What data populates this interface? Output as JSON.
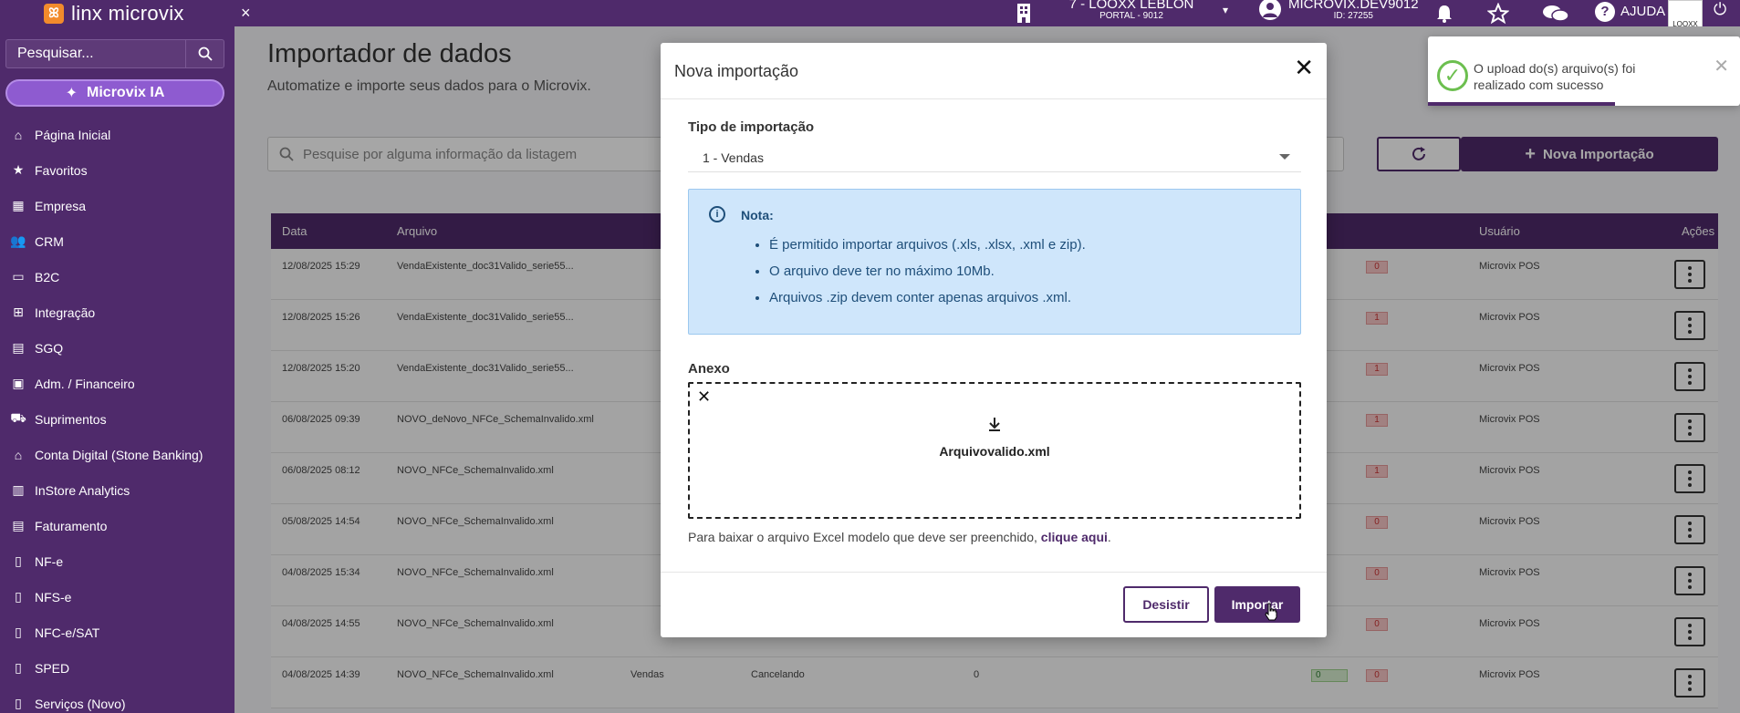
{
  "topbar": {
    "brand": "linx microvix",
    "close_glyph": "×",
    "store_name": "7 - LOOXX LEBLON",
    "store_portal": "PORTAL - 9012",
    "user_name": "MICROVIX.DEV9012",
    "user_id": "ID: 27255",
    "help_label": "AJUDA",
    "brand_badge": "LOOXX"
  },
  "sidebar": {
    "search_placeholder": "Pesquisar...",
    "ia_label": "Microvix IA",
    "items": [
      {
        "label": "Página Inicial",
        "icon": "home-icon"
      },
      {
        "label": "Favoritos",
        "icon": "star-icon"
      },
      {
        "label": "Empresa",
        "icon": "building-icon"
      },
      {
        "label": "CRM",
        "icon": "users-icon"
      },
      {
        "label": "B2C",
        "icon": "laptop-icon"
      },
      {
        "label": "Integração",
        "icon": "sitemap-icon"
      },
      {
        "label": "SGQ",
        "icon": "clipboard-icon"
      },
      {
        "label": "Adm. / Financeiro",
        "icon": "money-icon"
      },
      {
        "label": "Suprimentos",
        "icon": "truck-icon"
      },
      {
        "label": "Conta Digital (Stone Banking)",
        "icon": "bank-icon"
      },
      {
        "label": "InStore Analytics",
        "icon": "chart-icon"
      },
      {
        "label": "Faturamento",
        "icon": "invoice-icon"
      },
      {
        "label": "NF-e",
        "icon": "file-icon"
      },
      {
        "label": "NFS-e",
        "icon": "file-icon"
      },
      {
        "label": "NFC-e/SAT",
        "icon": "file-icon"
      },
      {
        "label": "SPED",
        "icon": "file-icon"
      },
      {
        "label": "Serviços (Novo)",
        "icon": "file-icon"
      }
    ]
  },
  "main": {
    "title": "Importador de dados",
    "subtitle": "Automatize e importe seus dados para o Microvix.",
    "search_placeholder": "Pesquise por alguma informação da listagem",
    "new_button": "Nova Importação",
    "columns": {
      "data": "Data",
      "arquivo": "Arquivo",
      "usuario": "Usuário",
      "acoes": "Ações"
    },
    "rows": [
      {
        "data": "12/08/2025 15:29",
        "arquivo": "VendaExistente_doc31Valido_serie55...",
        "usuario": "Microvix POS",
        "err": "0"
      },
      {
        "data": "12/08/2025 15:26",
        "arquivo": "VendaExistente_doc31Valido_serie55...",
        "usuario": "Microvix POS",
        "err": "1"
      },
      {
        "data": "12/08/2025 15:20",
        "arquivo": "VendaExistente_doc31Valido_serie55...",
        "usuario": "Microvix POS",
        "err": "1"
      },
      {
        "data": "06/08/2025 09:39",
        "arquivo": "NOVO_deNovo_NFCe_SchemaInvalido.xml",
        "usuario": "Microvix POS",
        "err": "1"
      },
      {
        "data": "06/08/2025 08:12",
        "arquivo": "NOVO_NFCe_SchemaInvalido.xml",
        "usuario": "Microvix POS",
        "err": "1"
      },
      {
        "data": "05/08/2025 14:54",
        "arquivo": "NOVO_NFCe_SchemaInvalido.xml",
        "usuario": "Microvix POS",
        "err": "0"
      },
      {
        "data": "04/08/2025 15:34",
        "arquivo": "NOVO_NFCe_SchemaInvalido.xml",
        "usuario": "Microvix POS",
        "err": "0"
      },
      {
        "data": "04/08/2025 14:55",
        "arquivo": "NOVO_NFCe_SchemaInvalido.xml",
        "usuario": "Microvix POS",
        "err": "0"
      },
      {
        "data": "04/08/2025 14:39",
        "arquivo": "NOVO_NFCe_SchemaInvalido.xml",
        "usuario": "Microvix POS",
        "err": "0",
        "tipo": "Vendas",
        "status": "Cancelando",
        "count": "0",
        "ok": "0"
      }
    ]
  },
  "modal": {
    "title": "Nova importação",
    "close_glyph": "✕",
    "tipo_label": "Tipo de importação",
    "tipo_value": "1 - Vendas",
    "note_title": "Nota:",
    "note_items": [
      "É permitido importar arquivos (.xls, .xlsx, .xml e zip).",
      "O arquivo deve ter no máximo 10Mb.",
      "Arquivos .zip devem conter apenas arquivos .xml."
    ],
    "anexo_label": "Anexo",
    "anexo_file": "Arquivovalido.xml",
    "download_text": "Para baixar o arquivo Excel modelo que deve ser preenchido, ",
    "download_link": "clique aqui",
    "download_end": ".",
    "cancel_label": "Desistir",
    "import_label": "Importar"
  },
  "toast": {
    "message": "O upload do(s) arquivo(s) foi realizado com sucesso",
    "progress": 0.6
  },
  "colors": {
    "primary": "#4f2a6b",
    "accent": "#8e5bd0",
    "success": "#6cbf4f"
  }
}
